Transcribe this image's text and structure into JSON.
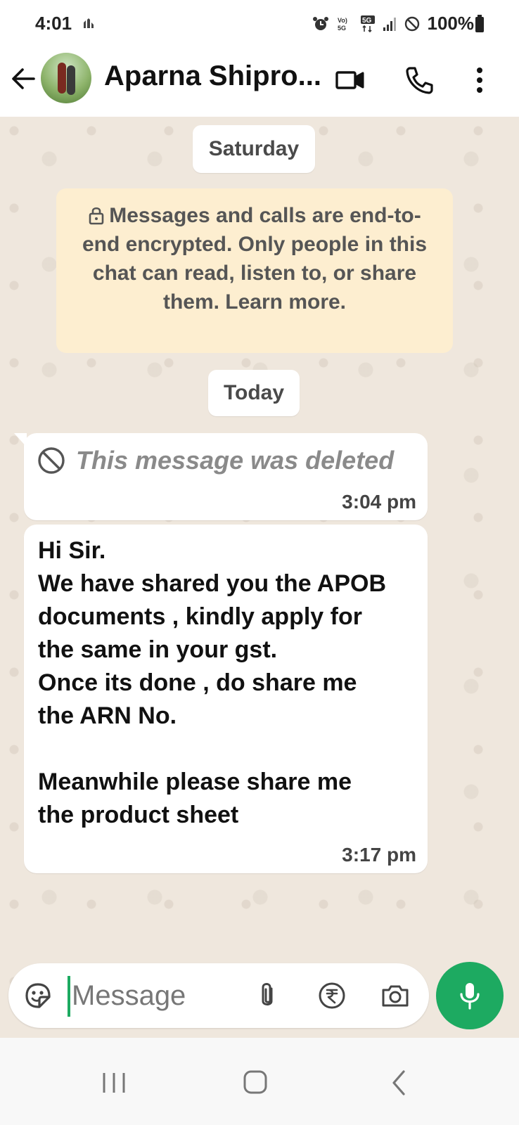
{
  "status_bar": {
    "time": "4:01",
    "battery": "100%",
    "network": "5G",
    "volte": "Vo) 5G"
  },
  "header": {
    "contact_name": "Aparna Shipro..."
  },
  "chat": {
    "date_chips": [
      "Saturday",
      "Today"
    ],
    "encryption_notice": "Messages and calls are end-to-end encrypted. Only people in this chat can read, listen to, or share them. Learn more.",
    "messages": [
      {
        "type": "deleted",
        "text": "This message was deleted",
        "time": "3:04 pm"
      },
      {
        "type": "text",
        "text": "Hi Sir.\nWe have shared you the APOB documents , kindly apply for the same in your gst.\nOnce its done , do share me the ARN No.\n\nMeanwhile please share me the product sheet",
        "time": "3:17 pm"
      }
    ]
  },
  "composer": {
    "placeholder": "Message"
  },
  "colors": {
    "accent_green": "#1daa61",
    "chat_background": "#efe7dd",
    "notice_background": "#fdeed0",
    "bubble_background": "#ffffff"
  },
  "icons": [
    "back-arrow-icon",
    "video-call-icon",
    "voice-call-icon",
    "more-options-icon",
    "lock-icon",
    "deleted-icon",
    "emoji-icon",
    "attach-icon",
    "rupee-icon",
    "camera-icon",
    "mic-icon"
  ]
}
